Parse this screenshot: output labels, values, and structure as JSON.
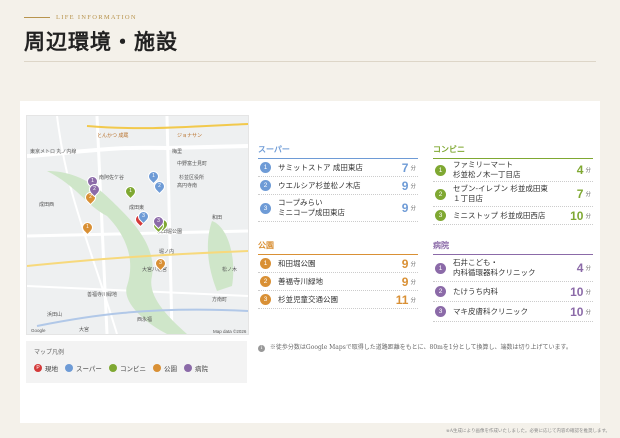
{
  "header": {
    "eyebrow": "LIFE INFORMATION",
    "title": "周辺環境・施設"
  },
  "legend": {
    "title": "マップ凡例",
    "items": [
      {
        "mark": "P",
        "label": "現地",
        "color": "#d43a3a"
      },
      {
        "mark": "",
        "label": "スーパー",
        "color": "#6e9bd6"
      },
      {
        "mark": "",
        "label": "コンビニ",
        "color": "#7fa832"
      },
      {
        "mark": "",
        "label": "公園",
        "color": "#d99035"
      },
      {
        "mark": "",
        "label": "病院",
        "color": "#8b6aa8"
      }
    ]
  },
  "categories": {
    "super": {
      "title": "スーパー",
      "color": "#6e9bd6",
      "items": [
        {
          "num": "1",
          "name": "サミットストア 成田東店",
          "time": "7",
          "unit": "分"
        },
        {
          "num": "2",
          "name": "ウエルシア杉並松ノ木店",
          "time": "9",
          "unit": "分"
        },
        {
          "num": "3",
          "name": "コープみらい\nミニコープ成田東店",
          "time": "9",
          "unit": "分"
        }
      ]
    },
    "park": {
      "title": "公園",
      "color": "#d99035",
      "items": [
        {
          "num": "1",
          "name": "和田堀公園",
          "time": "9",
          "unit": "分"
        },
        {
          "num": "2",
          "name": "善福寺川緑地",
          "time": "9",
          "unit": "分"
        },
        {
          "num": "3",
          "name": "杉並児童交通公園",
          "time": "11",
          "unit": "分"
        }
      ]
    },
    "conbini": {
      "title": "コンビニ",
      "color": "#7fa832",
      "items": [
        {
          "num": "1",
          "name": "ファミリーマート\n杉並松ノ木一丁目店",
          "time": "4",
          "unit": "分"
        },
        {
          "num": "2",
          "name": "セブン-イレブン 杉並成田東\n１丁目店",
          "time": "7",
          "unit": "分"
        },
        {
          "num": "3",
          "name": "ミニストップ 杉並成田西店",
          "time": "10",
          "unit": "分"
        }
      ]
    },
    "hospital": {
      "title": "病院",
      "color": "#8b6aa8",
      "items": [
        {
          "num": "1",
          "name": "石井こども・\n内科循環器科クリニック",
          "time": "4",
          "unit": "分"
        },
        {
          "num": "2",
          "name": "たけうち内科",
          "time": "10",
          "unit": "分"
        },
        {
          "num": "3",
          "name": "マキ皮膚科クリニック",
          "time": "10",
          "unit": "分"
        }
      ]
    }
  },
  "map": {
    "labels": [
      "東京メトロ 丸ノ内線",
      "中野富士見町",
      "梅里",
      "杉並区役所",
      "高円寺南",
      "南阿佐ケ谷",
      "成田西",
      "成田東",
      "和田堀公園",
      "大宮八幡宮",
      "松ノ木",
      "堀ノ内",
      "和田",
      "方南町",
      "大宮",
      "善福寺川緑地",
      "西永福",
      "浜田山",
      "ジョナサン",
      "とんかつ 成蔵",
      "Google",
      "Map data ©2026"
    ],
    "pins": [
      {
        "mark": "P",
        "color": "#d43a3a"
      },
      {
        "mark": "1",
        "color": "#6e9bd6"
      },
      {
        "mark": "2",
        "color": "#6e9bd6"
      },
      {
        "mark": "3",
        "color": "#6e9bd6"
      },
      {
        "mark": "1",
        "color": "#7fa832"
      },
      {
        "mark": "2",
        "color": "#7fa832"
      },
      {
        "mark": "3",
        "color": "#7fa832"
      },
      {
        "mark": "1",
        "color": "#d99035"
      },
      {
        "mark": "2",
        "color": "#d99035"
      },
      {
        "mark": "3",
        "color": "#d99035"
      },
      {
        "mark": "1",
        "color": "#8b6aa8"
      },
      {
        "mark": "2",
        "color": "#8b6aa8"
      },
      {
        "mark": "3",
        "color": "#8b6aa8"
      }
    ]
  },
  "footnote": "※徒歩分数はGoogle Mapsで取得した道路距離をもとに、80mを1分として換算し、端数は切り上げています。",
  "bottomnote": "※A生成により画像を作成いたしました。必要に応じて内容の確認を推奨します。"
}
